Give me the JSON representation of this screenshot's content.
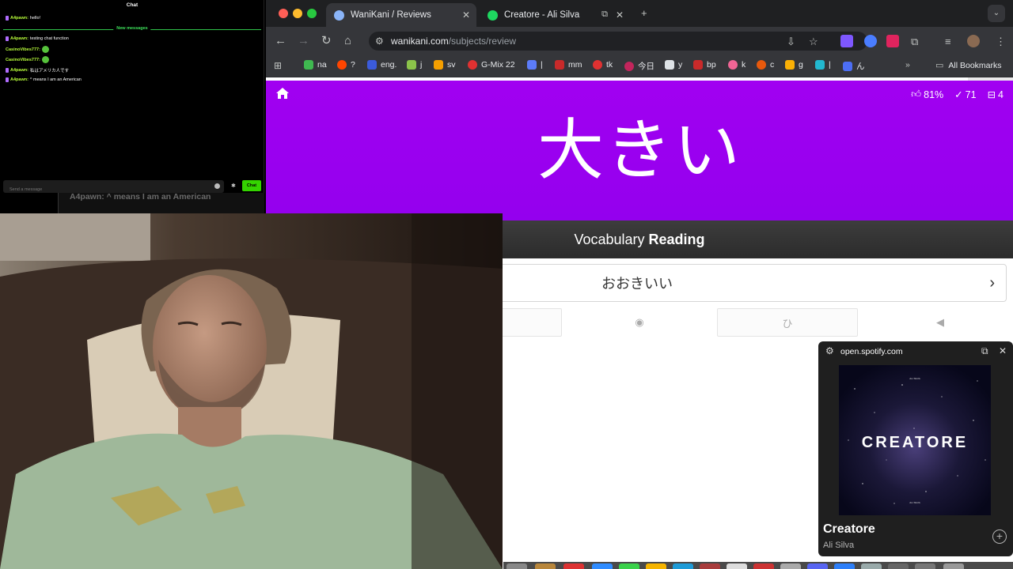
{
  "chat": {
    "title": "Chat",
    "messages_before": [
      {
        "user": "A4pawn:",
        "text": "hello!"
      }
    ],
    "new_messages_label": "New messages",
    "messages_after": [
      {
        "user": "A4pawn:",
        "text": "testing chat function"
      },
      {
        "user": "CasinoVibes777:",
        "text": ""
      },
      {
        "user": "CasinoVibes777:",
        "text": ""
      },
      {
        "user": "A4pawn:",
        "text": "私はアメリカ人です"
      },
      {
        "user": "A4pawn:",
        "text": "^ means I am an American"
      }
    ],
    "input_placeholder": "Send a message",
    "send_label": "Chat",
    "ghost_text": "A4pawn: ^ means I am an American"
  },
  "browser": {
    "tabs": [
      {
        "title": "WaniKani / Reviews",
        "active": true
      },
      {
        "title": "Creatore - Ali Silva",
        "active": false
      }
    ],
    "url_host": "wanikani.com",
    "url_path": "/subjects/review",
    "bookmarks": [
      "na",
      "?",
      "eng.",
      "j",
      "sv",
      "G-Mix 22",
      "|",
      "mm",
      "tk",
      "今日",
      "y",
      "bp",
      "k",
      "c",
      "g",
      "|",
      "ん"
    ],
    "all_bookmarks_label": "All Bookmarks"
  },
  "wanikani": {
    "progress_fraction": 0.94,
    "stats": {
      "percent": "81%",
      "completed": "71",
      "remaining": "4"
    },
    "character": "大きい",
    "question_type": "Vocabulary",
    "question_category": "Reading",
    "answer_value": "おおきいい",
    "kana_button": "ひ"
  },
  "spotify": {
    "host": "open.spotify.com",
    "album_text": "CREATORE",
    "art_small_text": "ALI SILVA",
    "track": "Creatore",
    "artist": "Ali Silva"
  },
  "colors": {
    "wanikani_vocab_purple": "#a100f1",
    "chat_send_green": "#34d400",
    "chat_username_green": "#b9ff3a"
  }
}
